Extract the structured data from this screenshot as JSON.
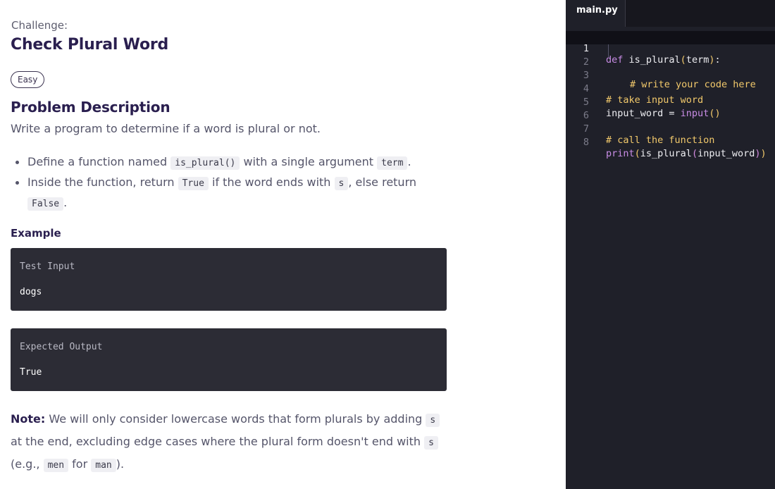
{
  "problem": {
    "challenge_label": "Challenge:",
    "title": "Check Plural Word",
    "difficulty": "Easy",
    "section_title": "Problem Description",
    "description": "Write a program to determine if a word is plural or not.",
    "bullets": {
      "b1_before": "Define a function named ",
      "b1_code1": "is_plural()",
      "b1_mid": " with a single argument ",
      "b1_code2": "term",
      "b1_after": ".",
      "b2_before": "Inside the function, return ",
      "b2_code1": "True",
      "b2_mid": " if the word ends with ",
      "b2_code2": "s",
      "b2_mid2": ", else return ",
      "b2_code3": "False",
      "b2_after": "."
    },
    "example_title": "Example",
    "test_input_label": "Test Input",
    "test_input_value": "dogs",
    "expected_output_label": "Expected Output",
    "expected_output_value": "True",
    "note": {
      "label": "Note:",
      "text1": " We will only consider lowercase words that form plurals by adding ",
      "code1": "s",
      "text2": " at the end, excluding edge cases where the plural form doesn't end with ",
      "code2": "s",
      "text3": " (e.g., ",
      "code3": "men",
      "text4": " for ",
      "code4": "man",
      "text5": ")."
    }
  },
  "editor": {
    "tab_label": "main.py",
    "line_numbers": [
      "1",
      "2",
      "3",
      "4",
      "5",
      "6",
      "7",
      "8"
    ],
    "lines": {
      "l1_kw": "def",
      "l1_name": " is_plural",
      "l1_paren_open": "(",
      "l1_arg": "term",
      "l1_paren_close": ")",
      "l1_colon": ":",
      "l2_comment": "# write your code here",
      "l4_comment": "# take input word",
      "l5_var": "input_word = ",
      "l5_fn": "input",
      "l5_parens": "()",
      "l7_comment": "# call the function",
      "l8_print": "print",
      "l8_p1": "(",
      "l8_inner": "is_plural",
      "l8_p2": "(",
      "l8_arg": "input_word",
      "l8_p3": ")",
      "l8_p4": ")"
    }
  }
}
